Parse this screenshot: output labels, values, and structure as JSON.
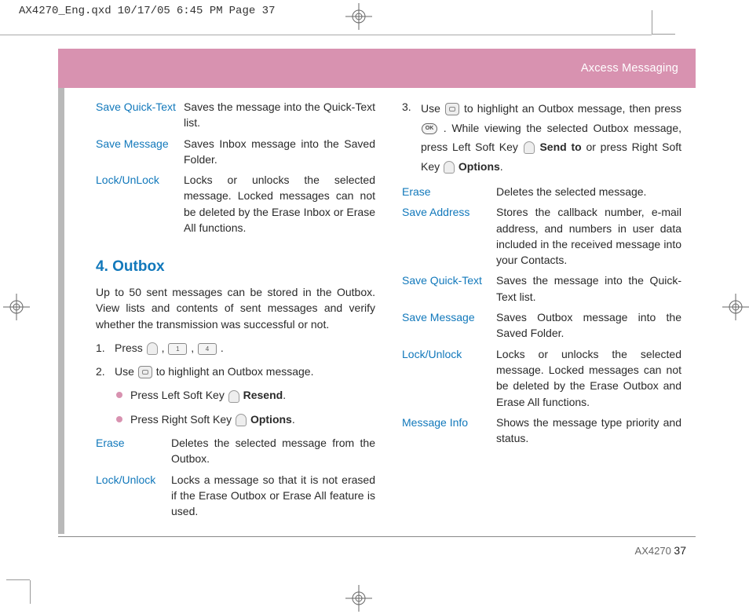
{
  "print_header": {
    "file": "AX4270_Eng.qxd",
    "date": "10/17/05",
    "time": "6:45 PM",
    "page": "Page 37"
  },
  "header_band": "Axcess Messaging",
  "left_col": {
    "defs_top": [
      {
        "term": "Save Quick-Text",
        "def": "Saves the message into the Quick-Text list."
      },
      {
        "term": "Save Message",
        "def": "Saves Inbox message into the Saved Folder."
      },
      {
        "term": "Lock/UnLock",
        "def": "Locks or unlocks the selected message. Locked messages can not be deleted by the Erase Inbox or Erase All functions."
      }
    ],
    "section_head": "4. Outbox",
    "section_intro": "Up to 50 sent messages can be stored in the Outbox. View lists and contents of sent messages and verify whether the transmission was successful or not.",
    "step1_label": "1.",
    "step1_pre": "Press ",
    "key1": "1",
    "key4": "4",
    "step2_label": "2.",
    "step2_pre": "Use ",
    "step2_post": " to highlight an Outbox message.",
    "bullet1_pre": "Press Left Soft Key ",
    "bullet1_bold": "Resend",
    "bullet2_pre": "Press Right Soft Key ",
    "bullet2_bold": "Options",
    "defs_bottom": [
      {
        "term": "Erase",
        "def": "Deletes the selected message from the Outbox."
      },
      {
        "term": "Lock/Unlock",
        "def": "Locks a message so that it is not erased if the Erase Outbox or Erase All feature is used."
      }
    ]
  },
  "right_col": {
    "step3_label": "3.",
    "step3_pre": "Use ",
    "step3_mid1": " to highlight an Outbox message, then press ",
    "step3_ok": "OK",
    "step3_mid2": ". While viewing the selected Outbox message, press Left Soft Key ",
    "step3_bold1": "Send to",
    "step3_mid3": " or press Right Soft Key ",
    "step3_bold2": "Options",
    "defs": [
      {
        "term": "Erase",
        "def": "Deletes the selected message."
      },
      {
        "term": "Save Address",
        "def": "Stores the callback number, e-mail address, and numbers in user data included in the received message into your Contacts."
      },
      {
        "term": "Save Quick-Text",
        "def": "Saves the message into the Quick-Text list."
      },
      {
        "term": "Save Message",
        "def": "Saves Outbox message into the Saved Folder."
      },
      {
        "term": "Lock/Unlock",
        "def": "Locks or unlocks the selected message. Locked messages can not be deleted by the Erase Outbox and Erase All functions."
      },
      {
        "term": "Message Info",
        "def": "Shows the message type priority and status."
      }
    ]
  },
  "footer": {
    "model": "AX4270",
    "page": "37"
  }
}
